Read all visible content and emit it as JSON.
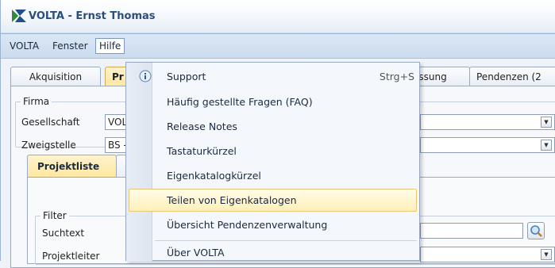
{
  "window": {
    "title": "VOLTA - Ernst Thomas"
  },
  "menubar": {
    "items": [
      "VOLTA",
      "Fenster",
      "Hilfe"
    ]
  },
  "tabs": {
    "akquisition": "Akquisition",
    "projekte_partial": "Pr",
    "erfassung_partial": "assung",
    "pendenzen_partial": "Pendenzen (2"
  },
  "firma": {
    "legend": "Firma",
    "gesellschaft_label": "Gesellschaft",
    "gesellschaft_value_partial": "VOL",
    "zweigstelle_label": "Zweigstelle",
    "zweigstelle_value_partial": "BS -"
  },
  "subtabs": {
    "projektliste": "Projektliste"
  },
  "filter": {
    "legend": "Filter",
    "suchtext_label": "Suchtext",
    "projektleiter_label": "Projektleiter"
  },
  "hilfe_menu": {
    "items": [
      {
        "label": "Support",
        "shortcut": "Strg+S"
      },
      {
        "label": "Häufig gestellte Fragen (FAQ)",
        "shortcut": ""
      },
      {
        "label": "Release Notes",
        "shortcut": ""
      },
      {
        "label": "Tastaturkürzel",
        "shortcut": ""
      },
      {
        "label": "Eigenkatalogkürzel",
        "shortcut": ""
      },
      {
        "label": "Teilen von Eigenkatalogen",
        "shortcut": ""
      },
      {
        "label": "Übersicht Pendenzenverwaltung",
        "shortcut": ""
      },
      {
        "label": "Über VOLTA",
        "shortcut": ""
      }
    ],
    "highlighted_index": 5
  },
  "colors": {
    "accent": "#ffe79e",
    "title": "#2a4d7c",
    "menubar": "#cbdcef"
  }
}
